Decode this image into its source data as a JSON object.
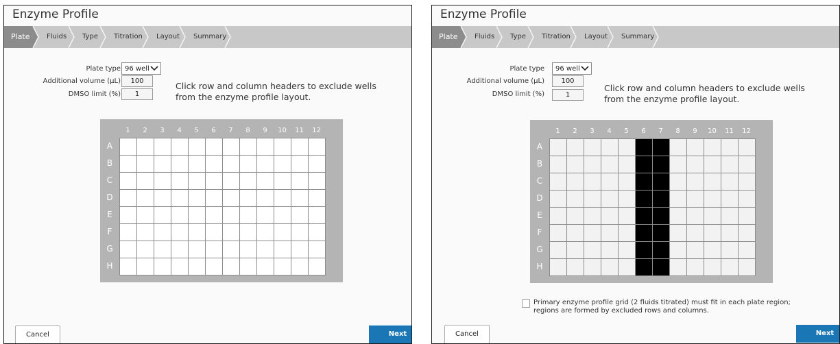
{
  "app": {
    "title": "Enzyme Profile",
    "steps": [
      "Plate",
      "Fluids",
      "Type",
      "Titration",
      "Layout",
      "Summary"
    ],
    "active_step": "Plate",
    "cancel_label": "Cancel",
    "next_label": "Next"
  },
  "colors": {
    "breadcrumb_bg": "#c8c8c8",
    "active_step_bg": "#8c8c8c",
    "plate_bg": "#b4b4b4",
    "next_button": "#1a76b4",
    "excluded_well": "#000000"
  },
  "form": {
    "plate_type_label": "Plate type",
    "plate_type_value": "96 well",
    "additional_volume_label": "Additional volume (µL)",
    "additional_volume_value": "100",
    "dmso_limit_label": "DMSO limit (%)",
    "dmso_limit_value": "1",
    "hint": "Click row and column headers to exclude wells from the enzyme profile layout."
  },
  "plate": {
    "columns": [
      "1",
      "2",
      "3",
      "4",
      "5",
      "6",
      "7",
      "8",
      "9",
      "10",
      "11",
      "12"
    ],
    "rows": [
      "A",
      "B",
      "C",
      "D",
      "E",
      "F",
      "G",
      "H"
    ]
  },
  "panels": [
    {
      "excluded_columns": [],
      "well_color": "#ffffff",
      "show_note": false
    },
    {
      "excluded_columns": [
        "6",
        "7"
      ],
      "well_color": "#f2f2f2",
      "show_note": true
    }
  ],
  "note": {
    "text": "Primary enzyme profile grid (2 fluids titrated) must fit in each plate region; regions are formed by excluded rows and columns.",
    "checked": false
  }
}
